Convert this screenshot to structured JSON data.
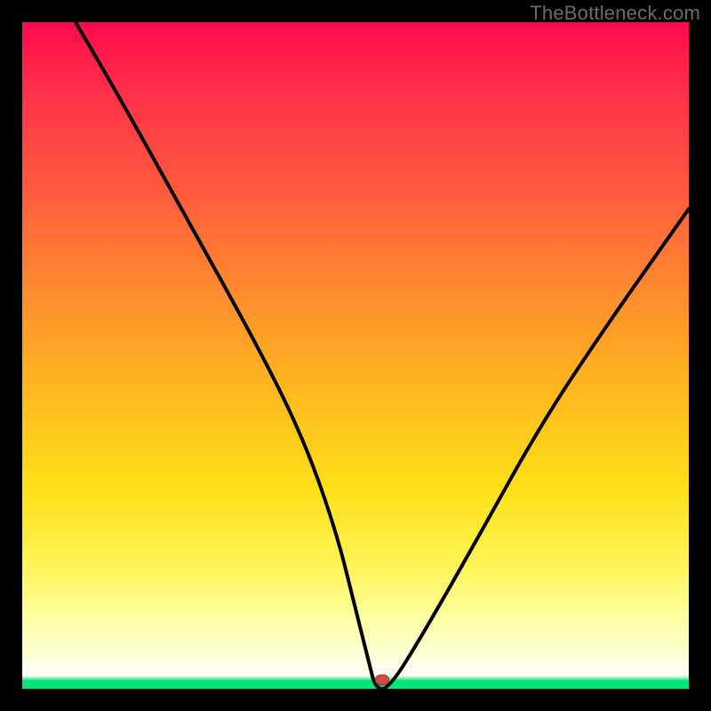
{
  "watermark": "TheBottleneck.com",
  "chart_data": {
    "type": "line",
    "title": "",
    "xlabel": "",
    "ylabel": "",
    "xlim": [
      0,
      100
    ],
    "ylim": [
      0,
      100
    ],
    "grid": false,
    "background": "heat-gradient",
    "series": [
      {
        "name": "bottleneck-curve",
        "x": [
          8,
          15,
          25,
          35,
          42,
          47,
          50,
          52,
          53,
          55,
          60,
          68,
          78,
          88,
          100
        ],
        "y": [
          100,
          88,
          70,
          52,
          38,
          24,
          12,
          4,
          0,
          0,
          8,
          22,
          40,
          55,
          72
        ]
      }
    ],
    "marker": {
      "x": 54,
      "y": 0,
      "color": "#d24a43"
    },
    "green_baseline_height_pct": 2
  }
}
